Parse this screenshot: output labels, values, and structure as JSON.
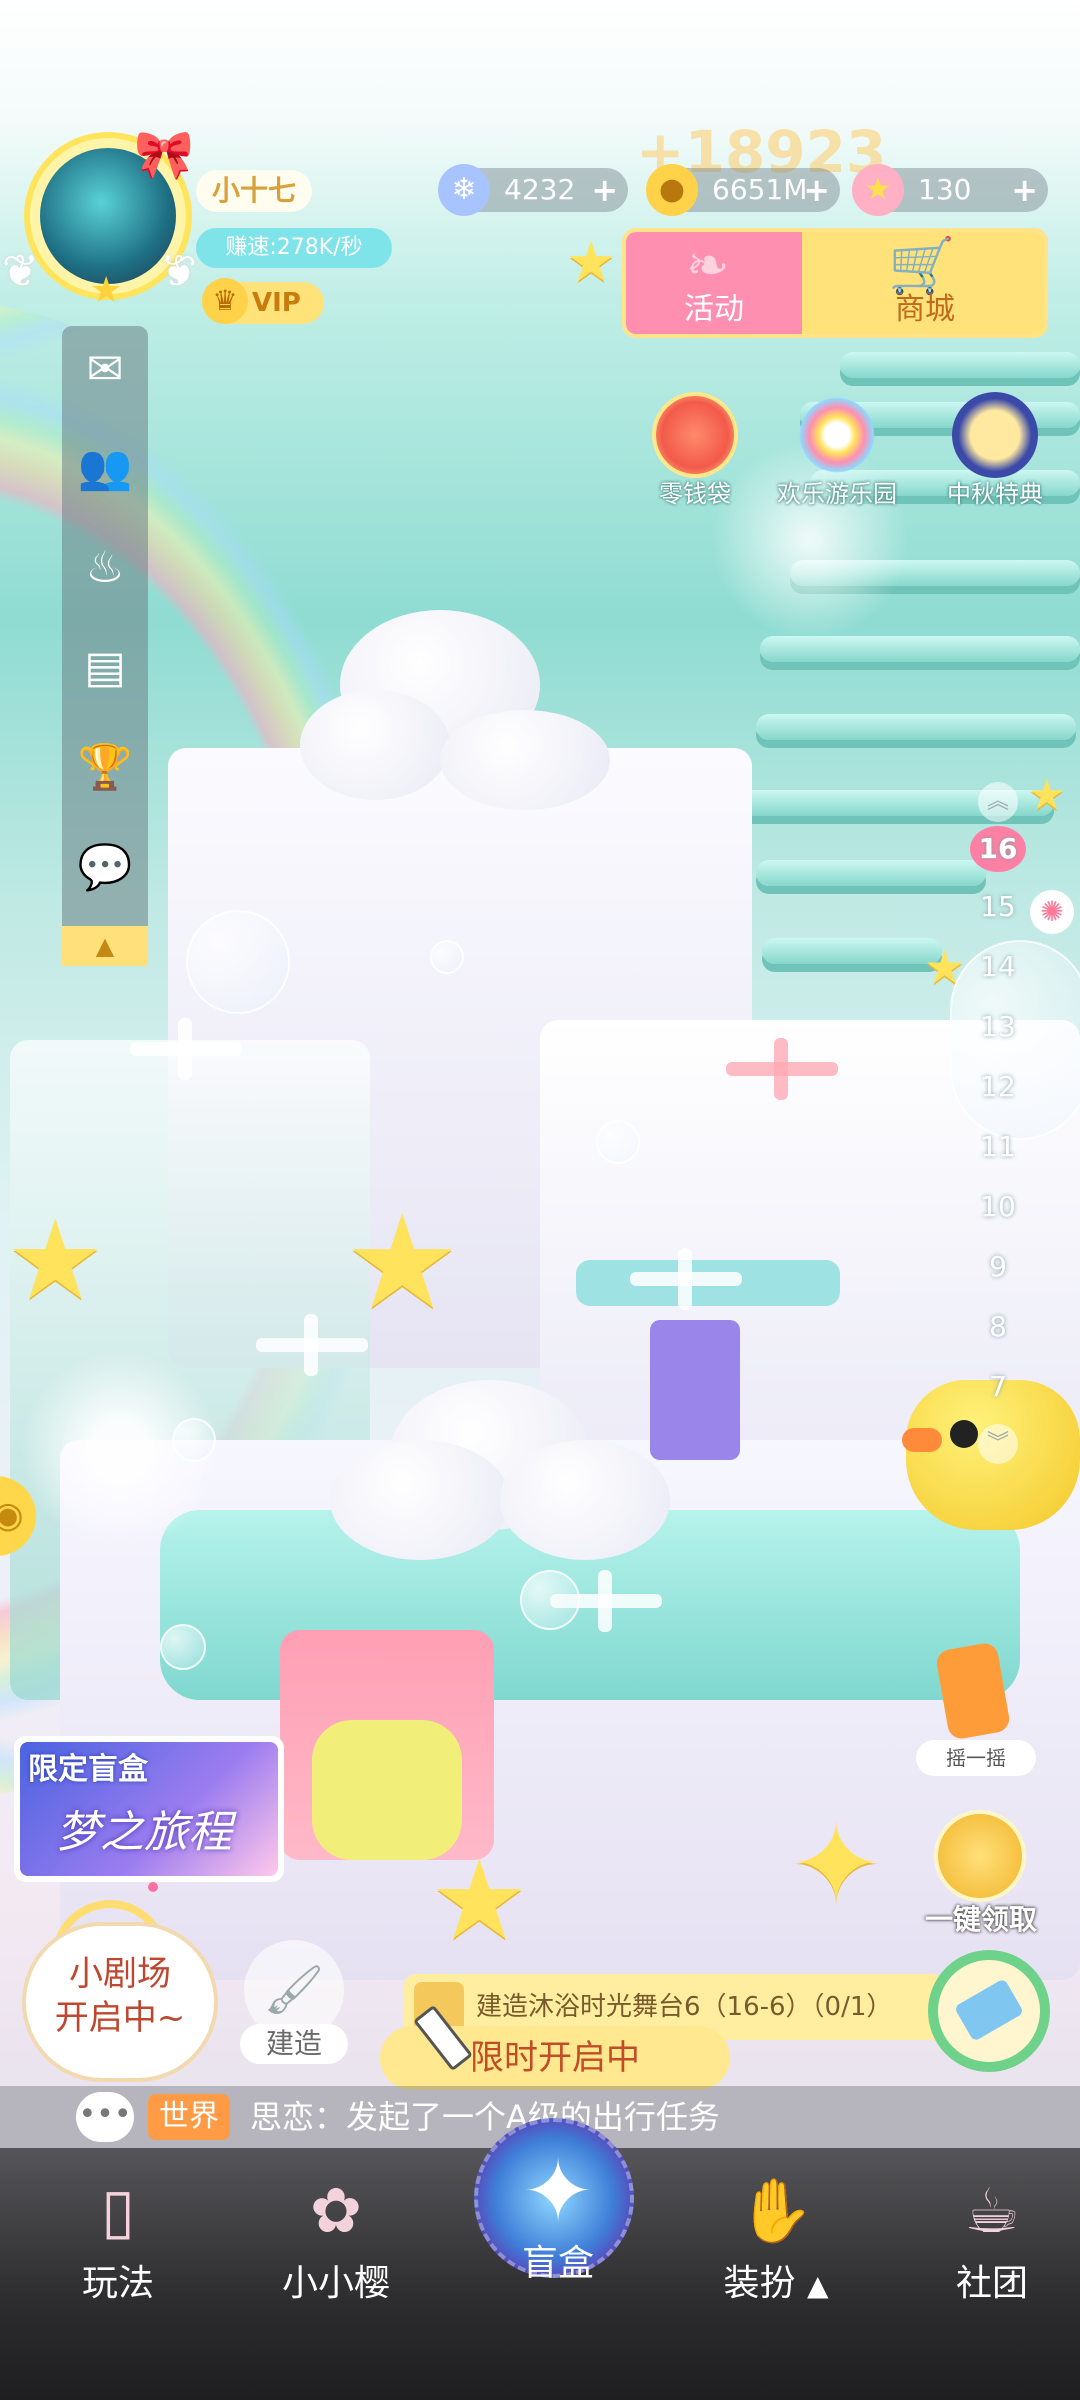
{
  "player": {
    "name": "小十七",
    "speed": "赚速:278K/秒",
    "vip": "VIP"
  },
  "resources": [
    {
      "icon": "crystal-icon",
      "value": "4232",
      "plus": "+"
    },
    {
      "icon": "coin-icon",
      "value": "6651M",
      "plus": "+"
    },
    {
      "icon": "star-icon",
      "value": "130",
      "plus": "+"
    }
  ],
  "floating_gain": "+18923",
  "top_buttons": {
    "activity": "活动",
    "shop": "商城"
  },
  "events": [
    {
      "label": "零钱袋"
    },
    {
      "label": "欢乐游乐园"
    },
    {
      "label": "中秋特典"
    }
  ],
  "floors": {
    "current": "16",
    "list": [
      "15",
      "14",
      "13",
      "12",
      "11",
      "10",
      "9",
      "8",
      "7"
    ]
  },
  "right_actions": {
    "shake": "摇一摇",
    "collect_all": "一键领取"
  },
  "limited_box": {
    "title": "限定盲盒",
    "subtitle": "梦之旅程"
  },
  "theater": {
    "line1": "小剧场",
    "line2": "开启中~"
  },
  "build_label": "建造",
  "task": {
    "text": "建造沐浴时光舞台6（16-6）（0/1）"
  },
  "limited_open": "限时开启中",
  "chat": {
    "channel": "世界",
    "message": "思恋：发起了一个A级的出行任务"
  },
  "nav": {
    "play": "玩法",
    "sakura": "小小樱",
    "blindbox": "盲盒",
    "dressup": "装扮",
    "club": "社团"
  }
}
